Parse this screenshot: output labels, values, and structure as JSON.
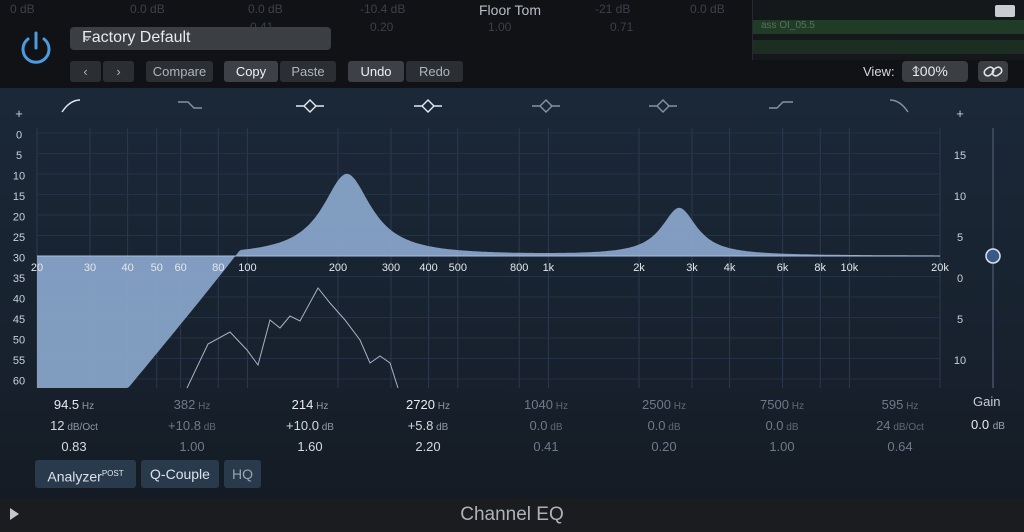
{
  "header": {
    "title": "Floor Tom",
    "preset": "Factory Default",
    "compare_label": "Compare",
    "copy_label": "Copy",
    "paste_label": "Paste",
    "undo_label": "Undo",
    "redo_label": "Redo",
    "view_label": "View:",
    "zoom_value": "100%",
    "ghost_values": [
      "0 dB",
      "0.0 dB",
      "0.0 dB",
      "-10.4 dB",
      "-21 dB",
      "0.0 dB",
      "0.41",
      "0.20",
      "1.00",
      "0.71"
    ],
    "track_label": "ass OI_05.5"
  },
  "icons": {
    "power": "power-icon",
    "prev": "chevron-left-icon",
    "next": "chevron-right-icon",
    "link": "link-icon",
    "play": "play-icon",
    "fullscreen": "fullscreen-icon"
  },
  "bands": [
    {
      "shape": "low-cut",
      "freq": "94.5",
      "freq_unit": "Hz",
      "gain": "12",
      "gain_unit": "dB/Oct",
      "q": "0.83",
      "enabled": true
    },
    {
      "shape": "low-shelf",
      "freq": "382",
      "freq_unit": "Hz",
      "gain": "+10.8",
      "gain_unit": "dB",
      "q": "1.00",
      "enabled": false
    },
    {
      "shape": "bell",
      "freq": "214",
      "freq_unit": "Hz",
      "gain": "+10.0",
      "gain_unit": "dB",
      "q": "1.60",
      "enabled": true
    },
    {
      "shape": "bell",
      "freq": "2720",
      "freq_unit": "Hz",
      "gain": "+5.8",
      "gain_unit": "dB",
      "q": "2.20",
      "enabled": true
    },
    {
      "shape": "bell",
      "freq": "1040",
      "freq_unit": "Hz",
      "gain": "0.0",
      "gain_unit": "dB",
      "q": "0.41",
      "enabled": false
    },
    {
      "shape": "bell",
      "freq": "2500",
      "freq_unit": "Hz",
      "gain": "0.0",
      "gain_unit": "dB",
      "q": "0.20",
      "enabled": false
    },
    {
      "shape": "high-shelf",
      "freq": "7500",
      "freq_unit": "Hz",
      "gain": "0.0",
      "gain_unit": "dB",
      "q": "1.00",
      "enabled": false
    },
    {
      "shape": "high-cut",
      "freq": "595",
      "freq_unit": "Hz",
      "gain": "24",
      "gain_unit": "dB/Oct",
      "q": "0.64",
      "enabled": false
    }
  ],
  "graph": {
    "freq_ticks": [
      "20",
      "30",
      "40",
      "50",
      "60",
      "80",
      "100",
      "200",
      "300",
      "400",
      "500",
      "800",
      "1k",
      "2k",
      "3k",
      "4k",
      "6k",
      "8k",
      "10k",
      "20k"
    ],
    "freq_values": [
      20,
      30,
      40,
      50,
      60,
      80,
      100,
      200,
      300,
      400,
      500,
      800,
      1000,
      2000,
      3000,
      4000,
      6000,
      8000,
      10000,
      20000
    ],
    "analyzer_ticks": [
      "+",
      "0",
      "5",
      "10",
      "15",
      "20",
      "25",
      "30",
      "35",
      "40",
      "45",
      "50",
      "55",
      "60",
      "-"
    ],
    "gain_ticks": [
      "+",
      "15",
      "10",
      "5",
      "0",
      "5",
      "10",
      "15",
      "-"
    ],
    "output_gain_label": "Gain",
    "output_gain_value": "0.0",
    "output_gain_unit": "dB"
  },
  "buttons": {
    "analyzer": "Analyzer",
    "analyzer_sup": "POST",
    "q_couple": "Q-Couple",
    "hq": "HQ"
  },
  "footer": {
    "title": "Channel EQ"
  },
  "colors": {
    "curve_fill": "#8aa7cc",
    "panel_bg": "#1b2838",
    "power_blue": "#4c9ce0"
  }
}
